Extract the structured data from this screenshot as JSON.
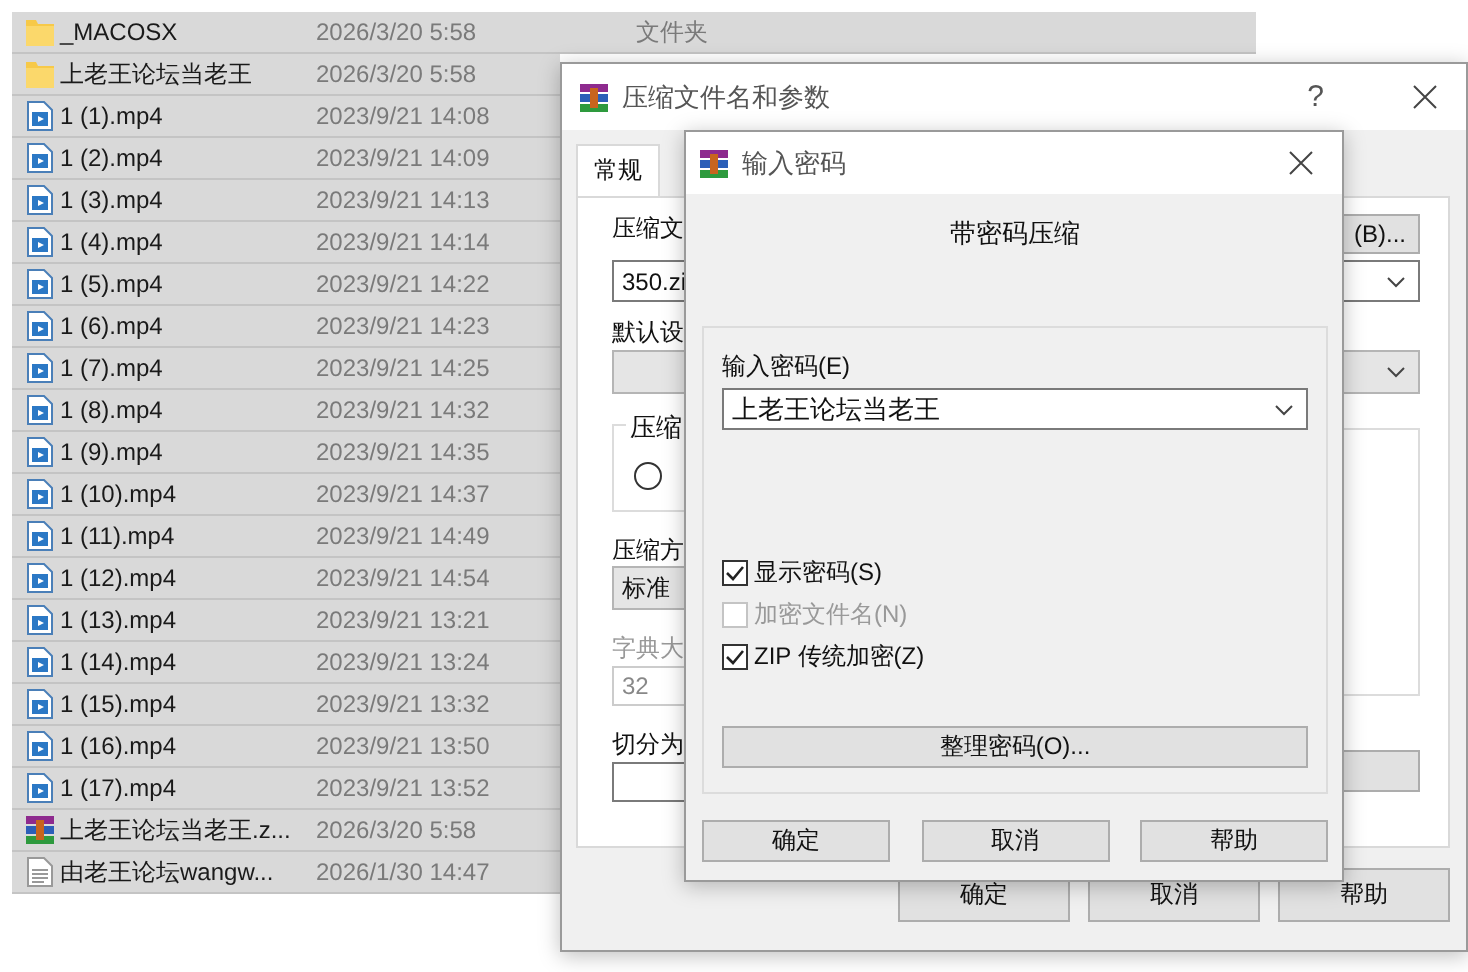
{
  "files": [
    {
      "kind": "folder",
      "name": "_MACOSX",
      "date": "2026/3/20 5:58",
      "type": "文件夹"
    },
    {
      "kind": "folder",
      "name": "上老王论坛当老王",
      "date": "2026/3/20 5:58"
    },
    {
      "kind": "video",
      "name": "1 (1).mp4",
      "date": "2023/9/21 14:08"
    },
    {
      "kind": "video",
      "name": "1 (2).mp4",
      "date": "2023/9/21 14:09"
    },
    {
      "kind": "video",
      "name": "1 (3).mp4",
      "date": "2023/9/21 14:13"
    },
    {
      "kind": "video",
      "name": "1 (4).mp4",
      "date": "2023/9/21 14:14"
    },
    {
      "kind": "video",
      "name": "1 (5).mp4",
      "date": "2023/9/21 14:22"
    },
    {
      "kind": "video",
      "name": "1 (6).mp4",
      "date": "2023/9/21 14:23"
    },
    {
      "kind": "video",
      "name": "1 (7).mp4",
      "date": "2023/9/21 14:25"
    },
    {
      "kind": "video",
      "name": "1 (8).mp4",
      "date": "2023/9/21 14:32"
    },
    {
      "kind": "video",
      "name": "1 (9).mp4",
      "date": "2023/9/21 14:35"
    },
    {
      "kind": "video",
      "name": "1 (10).mp4",
      "date": "2023/9/21 14:37"
    },
    {
      "kind": "video",
      "name": "1 (11).mp4",
      "date": "2023/9/21 14:49"
    },
    {
      "kind": "video",
      "name": "1 (12).mp4",
      "date": "2023/9/21 14:54"
    },
    {
      "kind": "video",
      "name": "1 (13).mp4",
      "date": "2023/9/21 13:21"
    },
    {
      "kind": "video",
      "name": "1 (14).mp4",
      "date": "2023/9/21 13:24"
    },
    {
      "kind": "video",
      "name": "1 (15).mp4",
      "date": "2023/9/21 13:32"
    },
    {
      "kind": "video",
      "name": "1 (16).mp4",
      "date": "2023/9/21 13:50"
    },
    {
      "kind": "video",
      "name": "1 (17).mp4",
      "date": "2023/9/21 13:52"
    },
    {
      "kind": "archive",
      "name": "上老王论坛当老王.z...",
      "date": "2026/3/20 5:58"
    },
    {
      "kind": "text",
      "name": "由老王论坛wangw...",
      "date": "2026/1/30 14:47"
    }
  ],
  "archive_dialog": {
    "title": "压缩文件名和参数",
    "help_glyph": "?",
    "tabs": [
      {
        "label": "常规",
        "selected": true
      }
    ],
    "archive_name_label": "压缩文",
    "browse_button": "(B)...",
    "archive_name": "350.zi",
    "profile_label": "默认设",
    "format_group_label": "压缩",
    "format_radio": {
      "checked": false
    },
    "method_label": "压缩方",
    "method": "标准",
    "dictionary_label": "字典大",
    "dictionary": "32",
    "dictionary_disabled": true,
    "split_label": "切分为",
    "buttons": [
      "确定",
      "取消",
      "帮助"
    ]
  },
  "password_dialog": {
    "title": "输入密码",
    "heading": "带密码压缩",
    "password_label": "输入密码(E)",
    "password": "上老王论坛当老王",
    "options": [
      {
        "label": "显示密码(S)",
        "checked": true,
        "disabled": false
      },
      {
        "label": "加密文件名(N)",
        "checked": false,
        "disabled": true
      },
      {
        "label": "ZIP 传统加密(Z)",
        "checked": true,
        "disabled": false
      }
    ],
    "organize_button": "整理密码(O)...",
    "buttons": [
      "确定",
      "取消",
      "帮助"
    ]
  }
}
